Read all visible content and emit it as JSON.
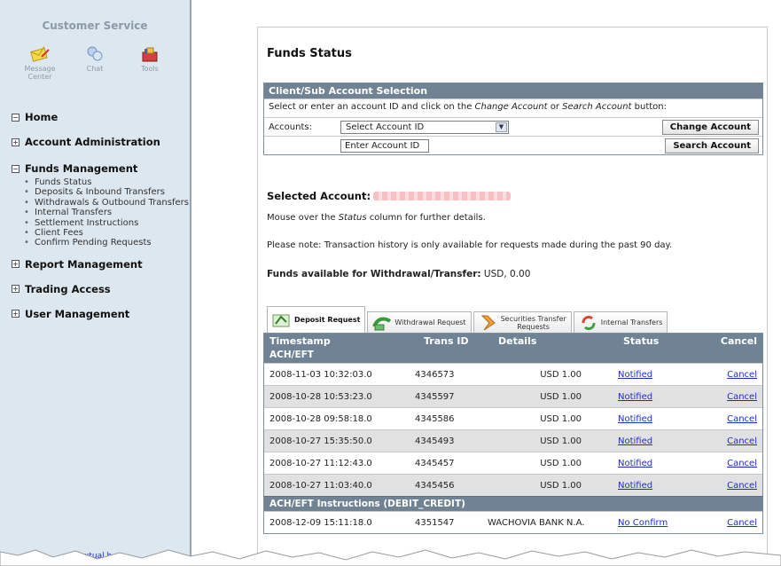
{
  "sidebar": {
    "title": "Customer Service",
    "icons": [
      {
        "label": "Message Center",
        "icon": "message-center-icon"
      },
      {
        "label": "Chat",
        "icon": "chat-icon"
      },
      {
        "label": "Tools",
        "icon": "tools-icon"
      }
    ],
    "nav": {
      "home": "Home",
      "account_admin": "Account Administration",
      "funds": "Funds Management",
      "funds_items": [
        "Funds Status",
        "Deposits & Inbound Transfers",
        "Withdrawals & Outbound Transfers",
        "Internal Transfers",
        "Settlement Instructions",
        "Client Fees",
        "Confirm Pending Requests"
      ],
      "report": "Report Management",
      "trading": "Trading Access",
      "user": "User Management"
    },
    "footer_link": "contextual h..."
  },
  "main": {
    "title": "Funds Status",
    "selection": {
      "header": "Client/Sub Account Selection",
      "instr_pre": "Select or enter an account ID and click on the ",
      "instr_change": "Change Account",
      "instr_or": " or ",
      "instr_search": "Search Account",
      "instr_post": " button:",
      "accounts_label": "Accounts:",
      "select_value": "Select Account ID",
      "change_btn": "Change Account",
      "account_id_value": "Enter Account ID",
      "search_btn": "Search Account"
    },
    "selected_account_label": "Selected Account:",
    "mouseover_pre": "Mouse over the ",
    "mouseover_status": "Status",
    "mouseover_post": " column for further details.",
    "note": "Please note: Transaction history is only available for requests made during the past 90 day.",
    "funds_avail_label": "Funds available for Withdrawal/Transfer:",
    "funds_avail_value": " USD, 0.00",
    "tabs": [
      {
        "label": "Deposit Request",
        "active": true
      },
      {
        "label": "Withdrawal Request",
        "active": false
      },
      {
        "label_line1": "Securities Transfer",
        "label_line2": "Requests",
        "active": false
      },
      {
        "label": "Internal Transfers",
        "active": false
      }
    ],
    "table": {
      "headers": {
        "timestamp": "Timestamp",
        "trans_id": "Trans ID",
        "details": "Details",
        "status": "Status",
        "cancel": "Cancel"
      },
      "groups": [
        {
          "name": "ACH/EFT",
          "rows": [
            {
              "timestamp": "2008-11-03 10:32:03.0",
              "trans_id": "4346573",
              "details": "",
              "amount": "USD 1.00",
              "status": "Notified",
              "cancel": "Cancel"
            },
            {
              "timestamp": "2008-10-28 10:53:23.0",
              "trans_id": "4345597",
              "details": "",
              "amount": "USD 1.00",
              "status": "Notified",
              "cancel": "Cancel"
            },
            {
              "timestamp": "2008-10-28 09:58:18.0",
              "trans_id": "4345586",
              "details": "",
              "amount": "USD 1.00",
              "status": "Notified",
              "cancel": "Cancel"
            },
            {
              "timestamp": "2008-10-27 15:35:50.0",
              "trans_id": "4345493",
              "details": "",
              "amount": "USD 1.00",
              "status": "Notified",
              "cancel": "Cancel"
            },
            {
              "timestamp": "2008-10-27 11:12:43.0",
              "trans_id": "4345457",
              "details": "",
              "amount": "USD 1.00",
              "status": "Notified",
              "cancel": "Cancel"
            },
            {
              "timestamp": "2008-10-27 11:03:40.0",
              "trans_id": "4345456",
              "details": "",
              "amount": "USD 1.00",
              "status": "Notified",
              "cancel": "Cancel"
            }
          ]
        },
        {
          "name": "ACH/EFT Instructions (DEBIT_CREDIT)",
          "rows": [
            {
              "timestamp": "2008-12-09 15:11:18.0",
              "trans_id": "4351547",
              "details": "WACHOVIA BANK N.A.",
              "amount": "",
              "status": "No Confirm",
              "cancel": "Cancel"
            }
          ]
        }
      ]
    }
  }
}
